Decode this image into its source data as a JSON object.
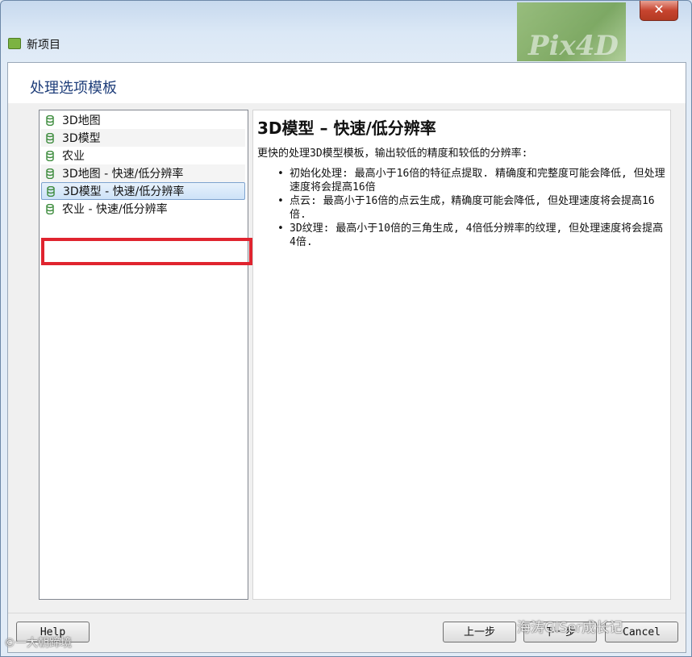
{
  "window": {
    "title": "新项目",
    "brand_text": "Pix4D",
    "close_symbol": "✕"
  },
  "page": {
    "title": "处理选项模板"
  },
  "templates": [
    {
      "label": "3D地图"
    },
    {
      "label": "3D模型"
    },
    {
      "label": "农业"
    },
    {
      "label": "3D地图 - 快速/低分辨率"
    },
    {
      "label": "3D模型 - 快速/低分辨率",
      "selected": true
    },
    {
      "label": "农业 - 快速/低分辨率"
    }
  ],
  "detail": {
    "title": "3D模型  –  快速/低分辨率",
    "description": "更快的处理3D模型模板，输出较低的精度和较低的分辨率:",
    "bullets": [
      "初始化处理: 最高小于16倍的特征点提取. 精确度和完整度可能会降低, 但处理速度将会提高16倍",
      "点云: 最高小于16倍的点云生成，精确度可能会降低, 但处理速度将会提高16倍.",
      "3D纹理: 最高小于10倍的三角生成, 4倍低分辨率的纹理, 但处理速度将会提高4倍."
    ]
  },
  "buttons": {
    "help": "Help",
    "prev": "上一步",
    "next": "下一步",
    "cancel": "Cancel"
  },
  "watermarks": {
    "left": "©一大朝蹄境",
    "right": "海涛GISer成长记"
  },
  "colors": {
    "highlight": "#e0242f",
    "title_text": "#1f3e7a",
    "db_icon": "#3c8b3c"
  }
}
